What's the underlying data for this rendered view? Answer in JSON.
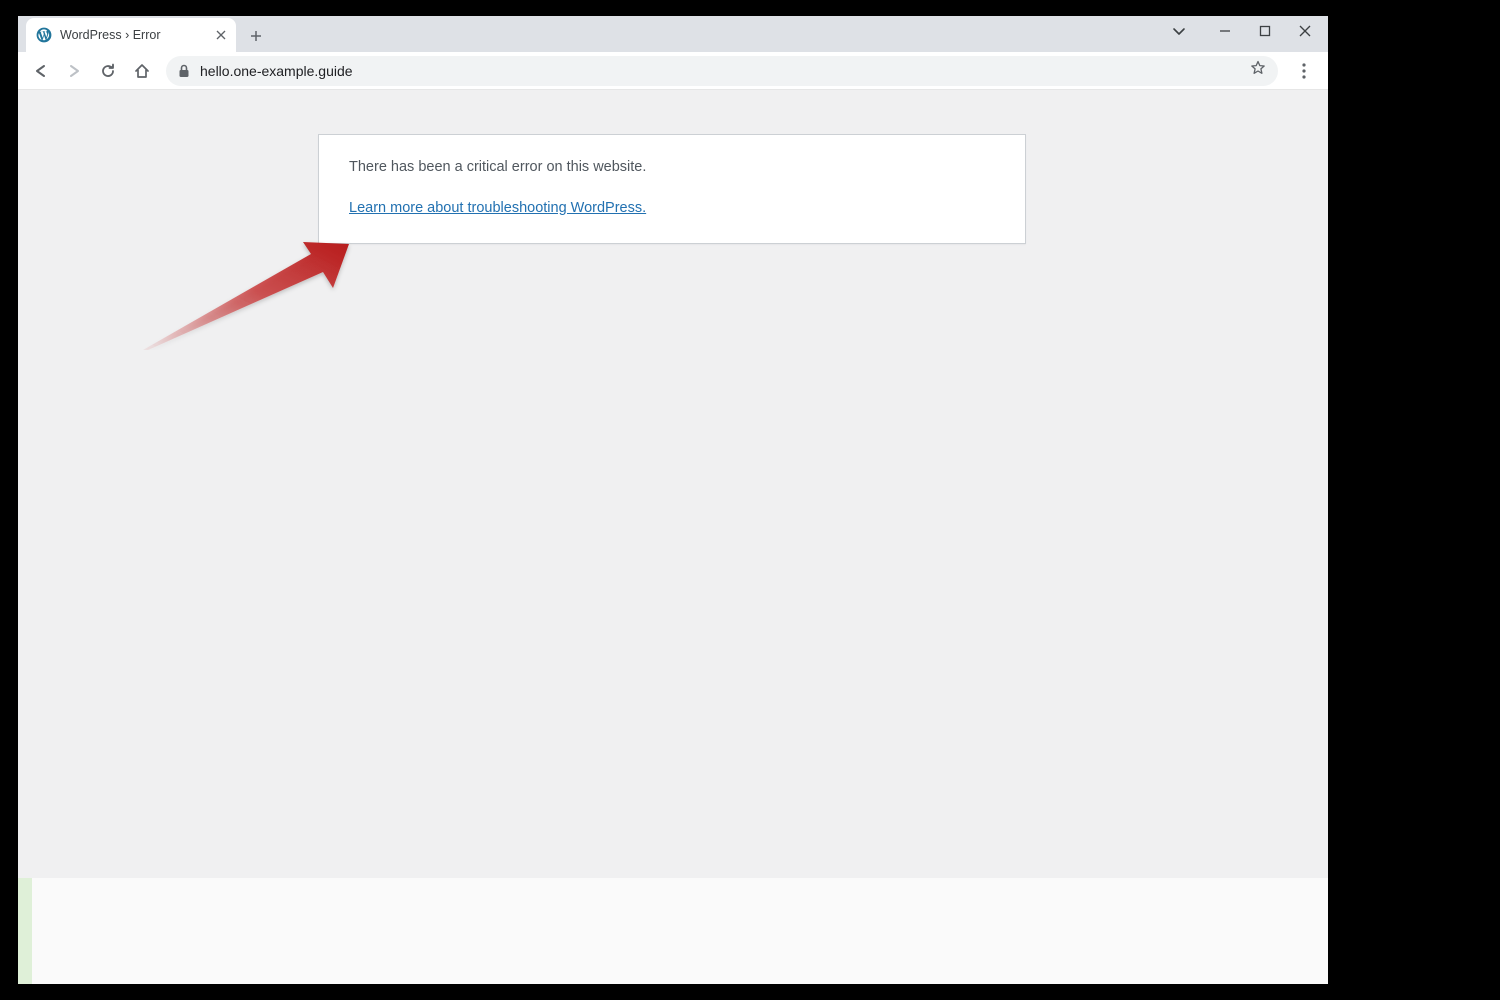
{
  "window": {
    "tab_title": "WordPress › Error",
    "url": "hello.one-example.guide"
  },
  "page": {
    "error_message": "There has been a critical error on this website.",
    "learn_more_text": "Learn more about troubleshooting WordPress."
  }
}
